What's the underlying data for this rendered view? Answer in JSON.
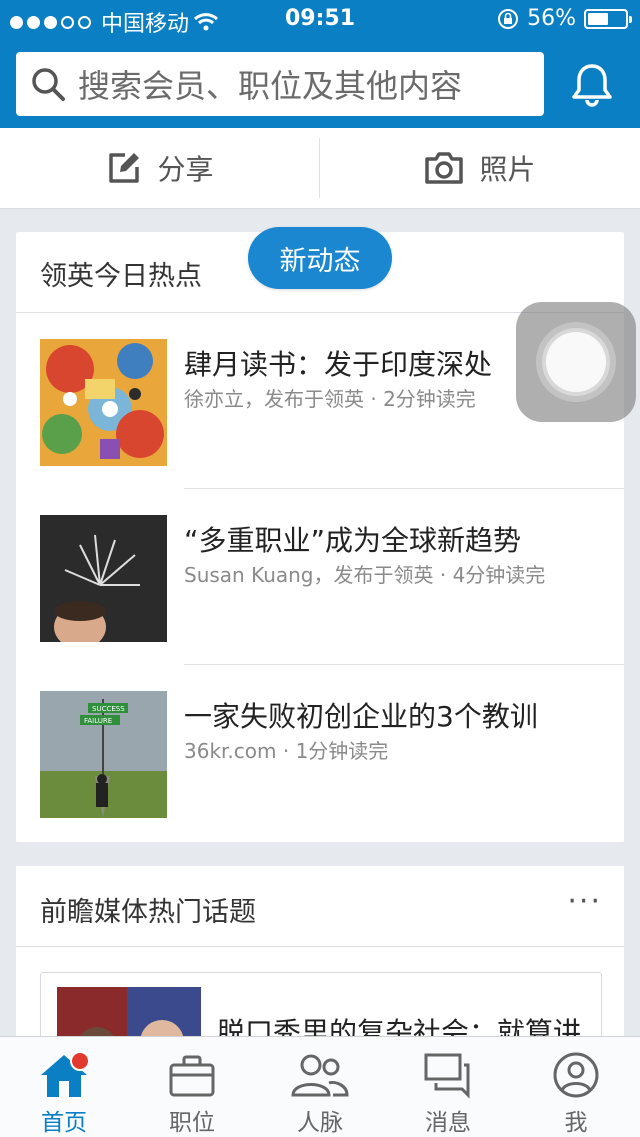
{
  "status": {
    "carrier": "中国移动",
    "time": "09:51",
    "battery_pct": "56%",
    "battery_level": 0.56
  },
  "search": {
    "placeholder": "搜索会员、职位及其他内容"
  },
  "share_bar": {
    "share_label": "分享",
    "photo_label": "照片"
  },
  "trending": {
    "title": "领英今日热点",
    "new_updates_label": "新动态",
    "articles": [
      {
        "title": "肆月读书：发于印度深处",
        "meta": "徐亦立，发布于领英 · 2分钟读完"
      },
      {
        "title": "“多重职业”成为全球新趋势",
        "meta": "Susan Kuang，发布于领英 · 4分钟读完"
      },
      {
        "title": "一家失败初创企业的3个教训",
        "meta": "36kr.com · 1分钟读完"
      }
    ]
  },
  "media": {
    "title": "前瞻媒体热门话题",
    "more_label": "···",
    "first_title": "脱口秀里的复杂社会：就算讲",
    "sign_success": "SUCCESS",
    "sign_failure": "FAILURE"
  },
  "tabs": [
    {
      "label": "首页",
      "active": true
    },
    {
      "label": "职位"
    },
    {
      "label": "人脉"
    },
    {
      "label": "消息"
    },
    {
      "label": "我"
    }
  ],
  "colors": {
    "brand": "#0b7fc4",
    "pill": "#1b87d0",
    "badge": "#e23a2e"
  }
}
